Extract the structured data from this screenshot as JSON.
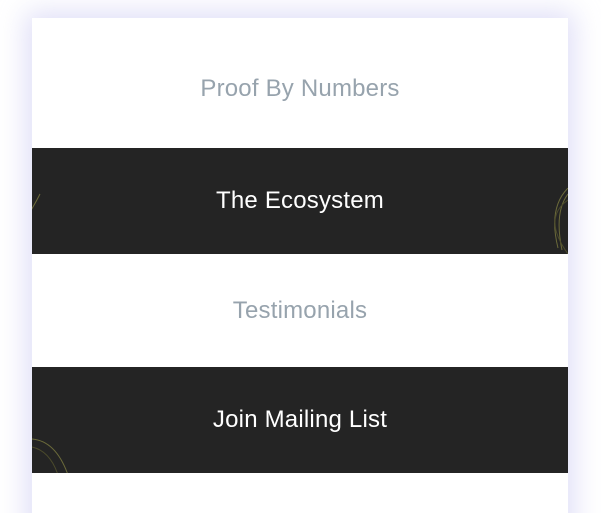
{
  "menu": {
    "items": [
      {
        "label": "Proof By Numbers",
        "style": "light"
      },
      {
        "label": "The Ecosystem",
        "style": "dark"
      },
      {
        "label": "Testimonials",
        "style": "light"
      },
      {
        "label": "Join Mailing List",
        "style": "dark"
      },
      {
        "label": "",
        "style": "light"
      }
    ]
  },
  "colors": {
    "dark_band": "#242424",
    "light_text": "#97a3ad",
    "dark_text": "#ffffff",
    "glow": "#c4c2f0",
    "decor_line": "#6b6a3a"
  }
}
